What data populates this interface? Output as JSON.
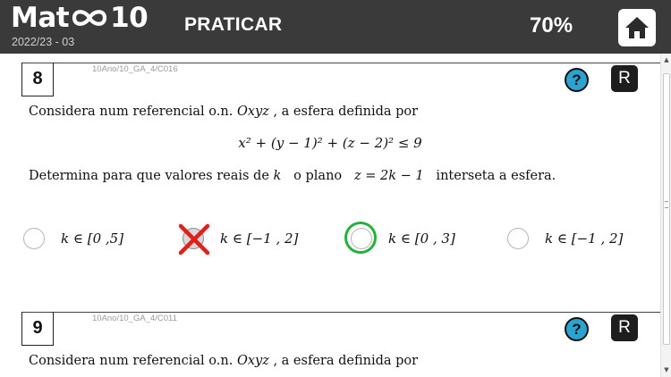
{
  "header": {
    "logo_left": "Mat",
    "logo_right": "10",
    "year": "2022/23 - 03",
    "mode": "PRATICAR",
    "progress": "70%",
    "home_icon": "home-icon"
  },
  "questions": [
    {
      "number": "8",
      "code": "10Ano/10_GA_4/C016",
      "help_label": "?",
      "r_label": "R",
      "intro_before": "Considera num referencial o.n. ",
      "intro_math": "Oxyz",
      "intro_after": " , a esfera definida por",
      "formula": "x² + (y − 1)² + (z − 2)² ≤ 9",
      "prompt_before": "Determina para que valores reais de ",
      "prompt_var": "k",
      "prompt_mid": "  o plano  ",
      "prompt_eq": "z = 2k − 1",
      "prompt_after": "  interseta a esfera.",
      "options": [
        {
          "label": "k ∈ [0 ,5]",
          "state": "unselected"
        },
        {
          "label": "k ∈ [−1 , 2]",
          "state": "selected-wrong"
        },
        {
          "label": "k ∈ [0 , 3]",
          "state": "correct"
        },
        {
          "label": "k ∈ [−1 , 2]",
          "state": "unselected"
        }
      ]
    },
    {
      "number": "9",
      "code": "10Ano/10_GA_4/C011",
      "help_label": "?",
      "r_label": "R",
      "intro_before": "Considera num referencial o.n. ",
      "intro_math": "Oxyz",
      "intro_after": " , a esfera definida por"
    }
  ],
  "colors": {
    "header_bg": "#3a3a3a",
    "help_button": "#2aa3d0",
    "correct_ring": "#22b33a",
    "wrong_cross": "#e0201c"
  }
}
